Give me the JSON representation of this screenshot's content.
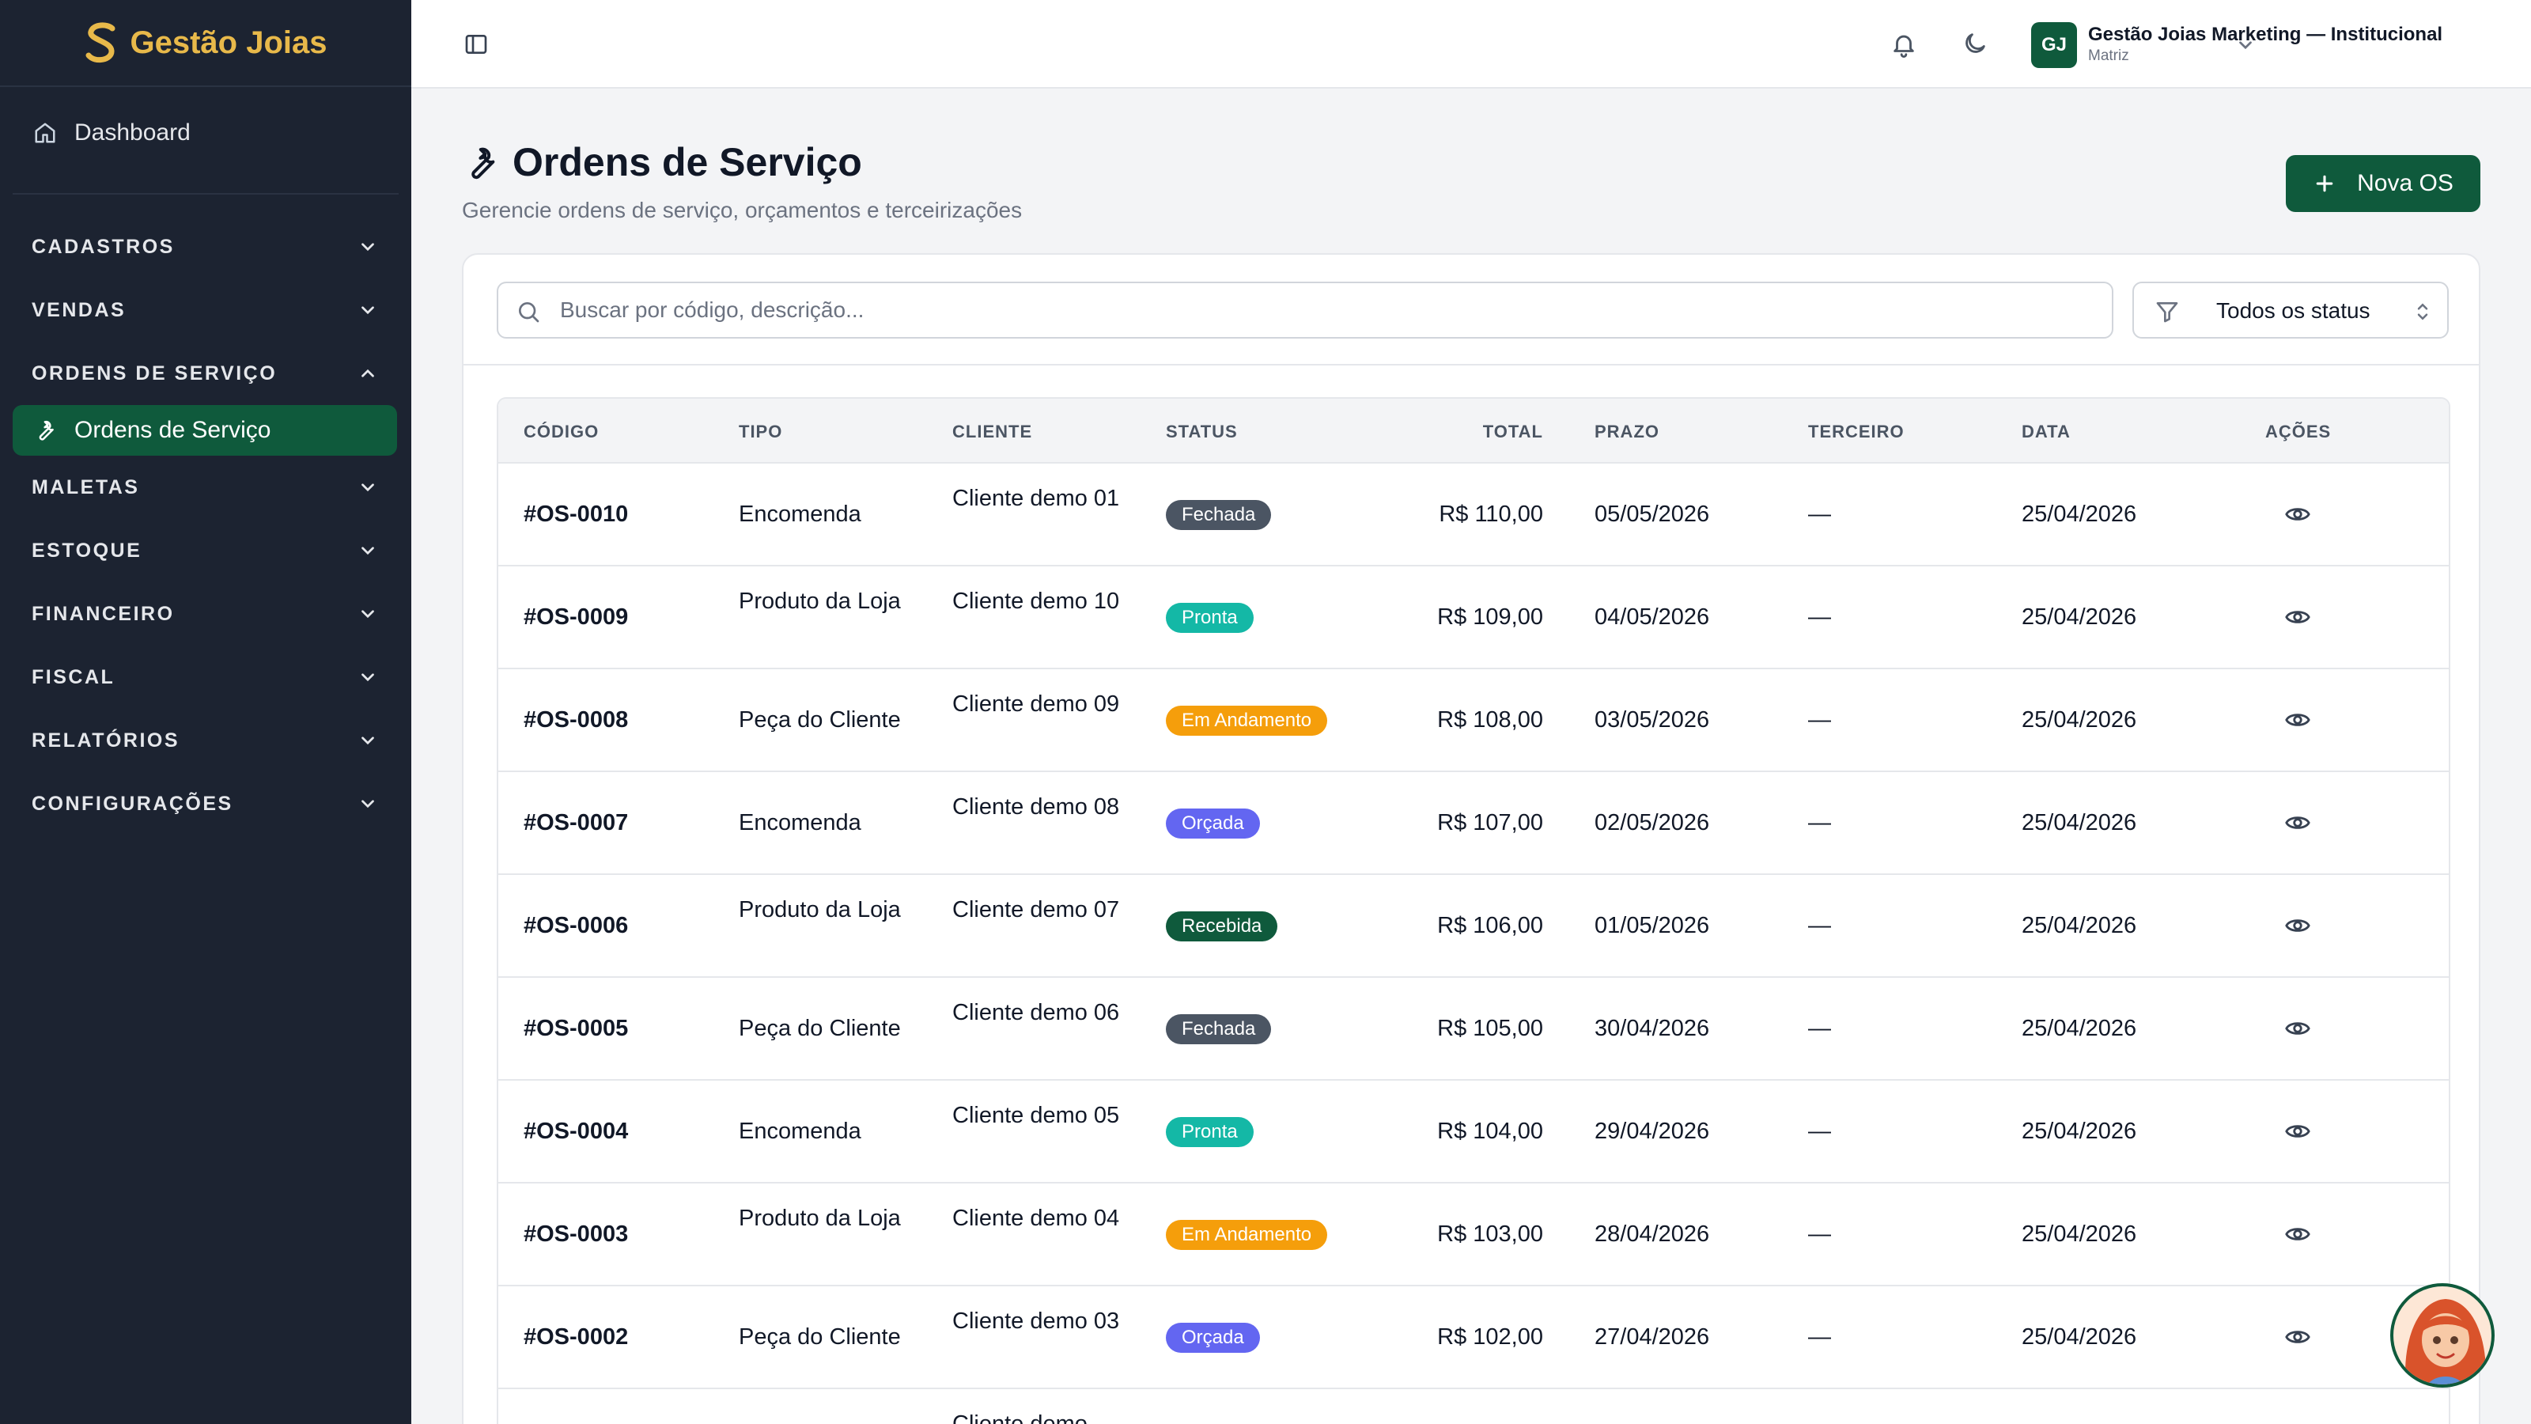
{
  "brand": {
    "name": "Gestão Joias"
  },
  "sidebar": {
    "dashboard": "Dashboard",
    "sections": {
      "cadastros": "CADASTROS",
      "vendas": "VENDAS",
      "ordens": "ORDENS DE SERVIÇO",
      "maletas": "MALETAS",
      "estoque": "ESTOQUE",
      "financeiro": "FINANCEIRO",
      "fiscal": "FISCAL",
      "relatorios": "RELATÓRIOS",
      "configuracoes": "CONFIGURAÇÕES"
    },
    "active_item": "Ordens de Serviço"
  },
  "topbar": {
    "avatar_initials": "GJ",
    "user_name": "Gestão Joias Marketing — Institucional",
    "user_sub": "Matriz"
  },
  "page": {
    "title": "Ordens de Serviço",
    "subtitle": "Gerencie ordens de serviço, orçamentos e terceirizações",
    "new_button": "Nova OS"
  },
  "filters": {
    "search_placeholder": "Buscar por código, descrição...",
    "status_selected": "Todos os status"
  },
  "table": {
    "headers": {
      "codigo": "CÓDIGO",
      "tipo": "TIPO",
      "cliente": "CLIENTE",
      "status": "STATUS",
      "total": "TOTAL",
      "prazo": "PRAZO",
      "terceiro": "TERCEIRO",
      "data": "DATA",
      "acoes": "AÇÕES"
    },
    "rows": [
      {
        "codigo": "#OS-0010",
        "tipo": "Encomenda",
        "cliente": "Cliente demo 01",
        "status": "Fechada",
        "total": "R$ 110,00",
        "prazo": "05/05/2026",
        "terceiro": "—",
        "data": "25/04/2026"
      },
      {
        "codigo": "#OS-0009",
        "tipo": "Produto da Loja",
        "cliente": "Cliente demo 10",
        "status": "Pronta",
        "total": "R$ 109,00",
        "prazo": "04/05/2026",
        "terceiro": "—",
        "data": "25/04/2026"
      },
      {
        "codigo": "#OS-0008",
        "tipo": "Peça do Cliente",
        "cliente": "Cliente demo 09",
        "status": "Em Andamento",
        "total": "R$ 108,00",
        "prazo": "03/05/2026",
        "terceiro": "—",
        "data": "25/04/2026"
      },
      {
        "codigo": "#OS-0007",
        "tipo": "Encomenda",
        "cliente": "Cliente demo 08",
        "status": "Orçada",
        "total": "R$ 107,00",
        "prazo": "02/05/2026",
        "terceiro": "—",
        "data": "25/04/2026"
      },
      {
        "codigo": "#OS-0006",
        "tipo": "Produto da Loja",
        "cliente": "Cliente demo 07",
        "status": "Recebida",
        "total": "R$ 106,00",
        "prazo": "01/05/2026",
        "terceiro": "—",
        "data": "25/04/2026"
      },
      {
        "codigo": "#OS-0005",
        "tipo": "Peça do Cliente",
        "cliente": "Cliente demo 06",
        "status": "Fechada",
        "total": "R$ 105,00",
        "prazo": "30/04/2026",
        "terceiro": "—",
        "data": "25/04/2026"
      },
      {
        "codigo": "#OS-0004",
        "tipo": "Encomenda",
        "cliente": "Cliente demo 05",
        "status": "Pronta",
        "total": "R$ 104,00",
        "prazo": "29/04/2026",
        "terceiro": "—",
        "data": "25/04/2026"
      },
      {
        "codigo": "#OS-0003",
        "tipo": "Produto da Loja",
        "cliente": "Cliente demo 04",
        "status": "Em Andamento",
        "total": "R$ 103,00",
        "prazo": "28/04/2026",
        "terceiro": "—",
        "data": "25/04/2026"
      },
      {
        "codigo": "#OS-0002",
        "tipo": "Peça do Cliente",
        "cliente": "Cliente demo 03",
        "status": "Orçada",
        "total": "R$ 102,00",
        "prazo": "27/04/2026",
        "terceiro": "—",
        "data": "25/04/2026"
      },
      {
        "codigo": "",
        "tipo": "",
        "cliente": "Cliente demo",
        "status": "",
        "total": "",
        "prazo": "",
        "terceiro": "",
        "data": ""
      }
    ]
  },
  "colors": {
    "primary": "#0f5a3c",
    "sidebar_bg": "#1c2331",
    "brand_gold": "#e8b94a",
    "status_fechada": "#4b5563",
    "status_pronta": "#14b8a6",
    "status_em_andamento": "#f59e0b",
    "status_orcada": "#6366f1",
    "status_recebida": "#0f5a3c"
  },
  "icons": {
    "logo": "gold-s-logo-icon",
    "dashboard": "home-icon",
    "active_item": "wrench-icon",
    "sidebar_toggle": "panel-toggle-icon",
    "notifications": "bell-icon",
    "theme": "moon-icon",
    "search": "search-icon",
    "filter": "filter-icon",
    "row_action": "eye-icon",
    "assistant": "assistant-avatar-icon"
  }
}
